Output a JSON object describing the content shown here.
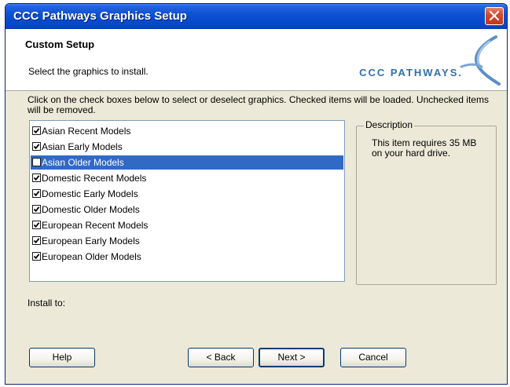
{
  "window": {
    "title": "CCC Pathways Graphics Setup"
  },
  "header": {
    "title": "Custom Setup",
    "subtitle": "Select the graphics to install.",
    "logo_text": "CCC PATHWAYS."
  },
  "instructions": "Click on the check boxes below to select or deselect graphics. Checked items will be loaded. Unchecked items will be removed.",
  "list": {
    "items": [
      {
        "label": "Asian Recent Models",
        "checked": true,
        "selected": false
      },
      {
        "label": "Asian Early Models",
        "checked": true,
        "selected": false
      },
      {
        "label": "Asian Older Models",
        "checked": false,
        "selected": true
      },
      {
        "label": "Domestic Recent Models",
        "checked": true,
        "selected": false
      },
      {
        "label": "Domestic Early Models",
        "checked": true,
        "selected": false
      },
      {
        "label": "Domestic Older Models",
        "checked": true,
        "selected": false
      },
      {
        "label": "European Recent Models",
        "checked": true,
        "selected": false
      },
      {
        "label": "European Early Models",
        "checked": true,
        "selected": false
      },
      {
        "label": "European Older Models",
        "checked": true,
        "selected": false
      }
    ]
  },
  "description": {
    "label": "Description",
    "text": "This item requires 35 MB on your hard drive."
  },
  "install": {
    "label": "Install to:"
  },
  "buttons": {
    "help": "Help",
    "back": "< Back",
    "next": "Next >",
    "cancel": "Cancel"
  },
  "colors": {
    "titlebar": "#0a4fd4",
    "selection": "#316ac5",
    "dialog_bg": "#ece9d8",
    "logo": "#2f6fae"
  }
}
